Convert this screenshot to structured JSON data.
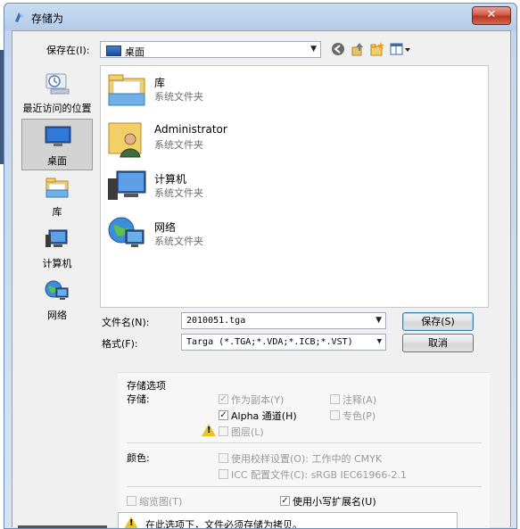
{
  "window": {
    "title": "存储为",
    "close_label": "✕"
  },
  "toolbar": {
    "save_in_label": "保存在(I):",
    "save_in_value": "桌面",
    "icons": [
      "back-icon",
      "up-folder-icon",
      "new-folder-icon",
      "view-menu-icon"
    ]
  },
  "places": [
    {
      "label": "最近访问的位置",
      "icon": "recent-places-icon"
    },
    {
      "label": "桌面",
      "icon": "desktop-icon",
      "selected": true
    },
    {
      "label": "库",
      "icon": "libraries-icon"
    },
    {
      "label": "计算机",
      "icon": "computer-icon"
    },
    {
      "label": "网络",
      "icon": "network-icon"
    }
  ],
  "files": [
    {
      "name": "库",
      "type": "系统文件夹",
      "icon": "library-folder-icon"
    },
    {
      "name": "Administrator",
      "type": "系统文件夹",
      "icon": "user-folder-icon"
    },
    {
      "name": "计算机",
      "type": "系统文件夹",
      "icon": "computer-icon"
    },
    {
      "name": "网络",
      "type": "系统文件夹",
      "icon": "network-icon"
    }
  ],
  "form": {
    "filename_label": "文件名(N):",
    "filename_value": "2010051.tga",
    "format_label": "格式(F):",
    "format_value": "Targa (*.TGA;*.VDA;*.ICB;*.VST)",
    "save_label": "保存(S)",
    "cancel_label": "取消"
  },
  "options": {
    "section_title": "存储选项",
    "store_label": "存储:",
    "as_copy": {
      "label": "作为副本(Y)",
      "checked": true,
      "disabled": true
    },
    "annotations": {
      "label": "注释(A)",
      "checked": false,
      "disabled": true
    },
    "alpha": {
      "label": "Alpha 通道(H)",
      "checked": true,
      "disabled": false
    },
    "spot": {
      "label": "专色(P)",
      "checked": false,
      "disabled": true
    },
    "layers": {
      "label": "图层(L)",
      "checked": false,
      "disabled": true
    },
    "color_label": "颜色:",
    "proof": {
      "label": "使用校样设置(O): 工作中的 CMYK",
      "checked": false,
      "disabled": true
    },
    "icc": {
      "label": "ICC 配置文件(C): sRGB IEC61966-2.1",
      "checked": false,
      "disabled": true
    },
    "thumbnail": {
      "label": "缩览图(T)",
      "checked": false,
      "disabled": true
    },
    "lowercase_ext": {
      "label": "使用小写扩展名(U)",
      "checked": true,
      "disabled": false
    },
    "warning_text": "在此选项下，文件必须存储为拷贝。"
  },
  "colors": {
    "selection": "#d3d3d3",
    "title_gradient": "#c9dcf2",
    "close": "#cf5a45",
    "warning": "#e8c51f"
  }
}
